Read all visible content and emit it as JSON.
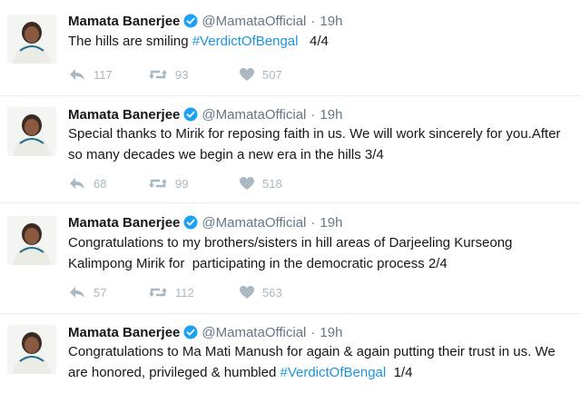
{
  "colors": {
    "link": "#1b95e0",
    "verified": "#1da1f2",
    "action_icon": "#aab8c2"
  },
  "tweets": [
    {
      "author_name": "Mamata Banerjee",
      "handle": "@MamataOfficial",
      "separator": "·",
      "time": "19h",
      "text_before": "The hills are smiling ",
      "hashtag": "#VerdictOfBengal",
      "text_after": "   4/4",
      "replies": "117",
      "retweets": "93",
      "likes": "507"
    },
    {
      "author_name": "Mamata Banerjee",
      "handle": "@MamataOfficial",
      "separator": "·",
      "time": "19h",
      "text_before": "Special thanks to Mirik for reposing faith in us. We will work sincerely for you.After so many decades we begin a new era in the hills 3/4",
      "hashtag": "",
      "text_after": "",
      "replies": "68",
      "retweets": "99",
      "likes": "518"
    },
    {
      "author_name": "Mamata Banerjee",
      "handle": "@MamataOfficial",
      "separator": "·",
      "time": "19h",
      "text_before": "Congratulations to my brothers/sisters in hill areas of Darjeeling Kurseong Kalimpong Mirik for  participating in the democratic process 2/4",
      "hashtag": "",
      "text_after": "",
      "replies": "57",
      "retweets": "112",
      "likes": "563"
    },
    {
      "author_name": "Mamata Banerjee",
      "handle": "@MamataOfficial",
      "separator": "·",
      "time": "19h",
      "text_before": "Congratulations to Ma Mati Manush for again & again putting their trust in us. We are honored, privileged & humbled ",
      "hashtag": "#VerdictOfBengal",
      "text_after": "  1/4"
    }
  ]
}
